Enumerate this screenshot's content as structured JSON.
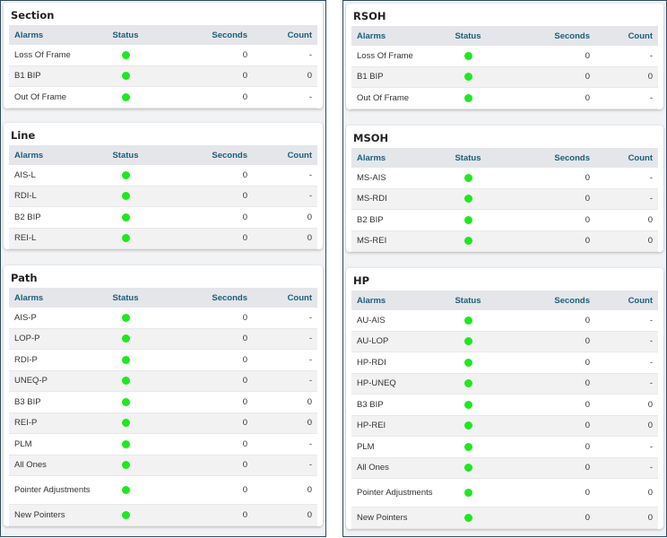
{
  "headers": {
    "alarms": "Alarms",
    "status": "Status",
    "seconds": "Seconds",
    "count": "Count"
  },
  "status_color": "#1ee81e",
  "left": {
    "section": {
      "title": "Section",
      "rows": [
        {
          "name": "Loss Of Frame",
          "seconds": "0",
          "count": "-"
        },
        {
          "name": "B1 BIP",
          "seconds": "0",
          "count": "0"
        },
        {
          "name": "Out Of Frame",
          "seconds": "0",
          "count": "-"
        }
      ]
    },
    "line": {
      "title": "Line",
      "rows": [
        {
          "name": "AIS-L",
          "seconds": "0",
          "count": "-"
        },
        {
          "name": "RDI-L",
          "seconds": "0",
          "count": "-"
        },
        {
          "name": "B2 BIP",
          "seconds": "0",
          "count": "0"
        },
        {
          "name": "REI-L",
          "seconds": "0",
          "count": "0"
        }
      ]
    },
    "path": {
      "title": "Path",
      "rows": [
        {
          "name": "AIS-P",
          "seconds": "0",
          "count": "-"
        },
        {
          "name": "LOP-P",
          "seconds": "0",
          "count": "-"
        },
        {
          "name": "RDI-P",
          "seconds": "0",
          "count": "-"
        },
        {
          "name": "UNEQ-P",
          "seconds": "0",
          "count": "-"
        },
        {
          "name": "B3 BIP",
          "seconds": "0",
          "count": "0"
        },
        {
          "name": "REI-P",
          "seconds": "0",
          "count": "0"
        },
        {
          "name": "PLM",
          "seconds": "0",
          "count": "-"
        },
        {
          "name": "All Ones",
          "seconds": "0",
          "count": "-"
        },
        {
          "name": "Pointer Adjustments",
          "seconds": "0",
          "count": "0"
        },
        {
          "name": "New Pointers",
          "seconds": "0",
          "count": "0"
        }
      ]
    }
  },
  "right": {
    "rsoh": {
      "title": "RSOH",
      "rows": [
        {
          "name": "Loss Of Frame",
          "seconds": "0",
          "count": "-"
        },
        {
          "name": "B1 BIP",
          "seconds": "0",
          "count": "0"
        },
        {
          "name": "Out Of Frame",
          "seconds": "0",
          "count": "-"
        }
      ]
    },
    "msoh": {
      "title": "MSOH",
      "rows": [
        {
          "name": "MS-AIS",
          "seconds": "0",
          "count": "-"
        },
        {
          "name": "MS-RDI",
          "seconds": "0",
          "count": "-"
        },
        {
          "name": "B2 BIP",
          "seconds": "0",
          "count": "0"
        },
        {
          "name": "MS-REI",
          "seconds": "0",
          "count": "0"
        }
      ]
    },
    "hp": {
      "title": "HP",
      "rows": [
        {
          "name": "AU-AIS",
          "seconds": "0",
          "count": "-"
        },
        {
          "name": "AU-LOP",
          "seconds": "0",
          "count": "-"
        },
        {
          "name": "HP-RDI",
          "seconds": "0",
          "count": "-"
        },
        {
          "name": "HP-UNEQ",
          "seconds": "0",
          "count": "-"
        },
        {
          "name": "B3 BIP",
          "seconds": "0",
          "count": "0"
        },
        {
          "name": "HP-REI",
          "seconds": "0",
          "count": "0"
        },
        {
          "name": "PLM",
          "seconds": "0",
          "count": "-"
        },
        {
          "name": "All Ones",
          "seconds": "0",
          "count": "-"
        },
        {
          "name": "Pointer Adjustments",
          "seconds": "0",
          "count": "0"
        },
        {
          "name": "New Pointers",
          "seconds": "0",
          "count": "0"
        }
      ]
    }
  }
}
